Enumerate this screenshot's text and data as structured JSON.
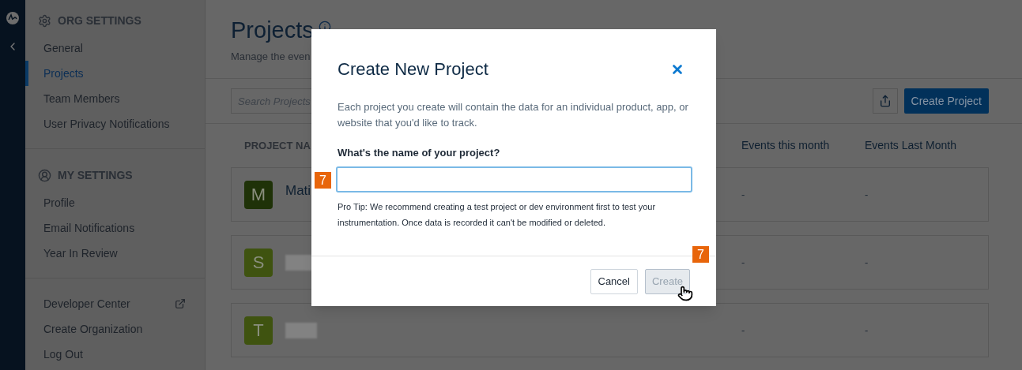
{
  "sidebar": {
    "sections": [
      {
        "kind": "org",
        "title": "ORG SETTINGS",
        "items": [
          {
            "label": "General",
            "selected": false
          },
          {
            "label": "Projects",
            "selected": true
          },
          {
            "label": "Team Members",
            "selected": false
          },
          {
            "label": "User Privacy Notifications",
            "selected": false
          }
        ]
      },
      {
        "kind": "user",
        "title": "MY SETTINGS",
        "items": [
          {
            "label": "Profile",
            "selected": false
          },
          {
            "label": "Email Notifications",
            "selected": false
          },
          {
            "label": "Year In Review",
            "selected": false
          }
        ]
      }
    ],
    "links": [
      {
        "label": "Developer Center",
        "external": true
      },
      {
        "label": "Create Organization",
        "external": false
      },
      {
        "label": "Log Out",
        "external": false
      }
    ]
  },
  "page": {
    "title": "Projects",
    "subtitle": "Manage the even",
    "search": {
      "placeholder": "Search Projects"
    },
    "create_button": "Create Project"
  },
  "table": {
    "columns": [
      "PROJECT NA",
      "Events this month",
      "Events Last Month"
    ],
    "rows": [
      {
        "initial": "M",
        "color": "#1f3208",
        "name": "Mati",
        "blurred": false,
        "this_month": "-",
        "last_month": "-"
      },
      {
        "initial": "S",
        "color": "#3f5310",
        "blurred": true,
        "this_month": "-",
        "last_month": "-"
      },
      {
        "initial": "T",
        "color": "#3f5310",
        "blurred": true,
        "this_month": "-",
        "last_month": "-"
      }
    ]
  },
  "modal": {
    "title": "Create New Project",
    "description": "Each project you create will contain the data for an individual product, app, or website that you'd like to track.",
    "field_label": "What's the name of your project?",
    "tip": "Pro Tip: We recommend creating a test project or dev environment first to test your instrumentation. Once data is recorded it can't be modified or deleted.",
    "cancel": "Cancel",
    "create": "Create",
    "create_disabled": true
  },
  "markers": [
    "7",
    "7"
  ]
}
